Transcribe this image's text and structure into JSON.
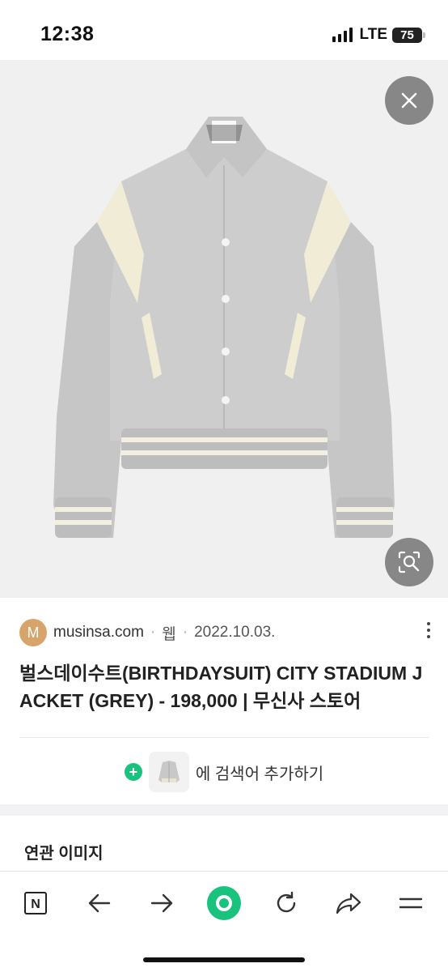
{
  "status_bar": {
    "time": "12:38",
    "network": "LTE",
    "battery": "75"
  },
  "image_viewer": {
    "close_icon": "close-icon",
    "lens_icon": "image-search-icon",
    "colors": {
      "background": "#f0f0f0",
      "jacket_body": "#c9c9c9",
      "leather_accent": "#f1ecd6"
    }
  },
  "result": {
    "favicon_letter": "M",
    "domain": "musinsa.com",
    "separator": "·",
    "type": "웹",
    "date": "2022.10.03.",
    "title": "벌스데이수트(BIRTHDAYSUIT) CITY STADIUM JACKET (GREY) - 198,000 | 무신사 스토어",
    "add_keyword_plus": "+",
    "add_keyword_label": "에 검색어 추가하기"
  },
  "related": {
    "heading": "연관 이미지"
  },
  "toolbar": {
    "items": [
      "naver-icon",
      "back-arrow-icon",
      "forward-arrow-icon",
      "green-dot-icon",
      "refresh-icon",
      "share-icon",
      "menu-icon"
    ],
    "naver_letter": "N",
    "accent": "#19c37d"
  }
}
